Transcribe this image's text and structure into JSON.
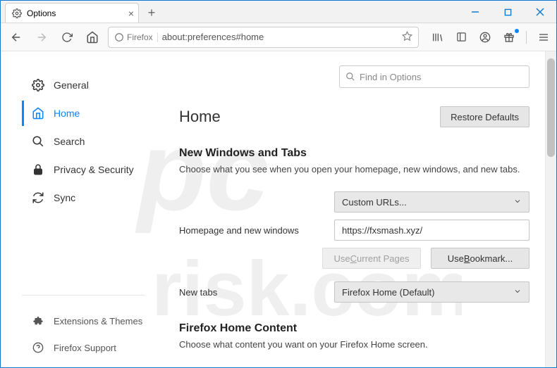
{
  "titlebar": {
    "tab_title": "Options"
  },
  "navbar": {
    "identity_label": "Firefox",
    "address": "about:preferences#home",
    "search_placeholder": "Find in Options"
  },
  "sidebar": {
    "items": [
      {
        "label": "General"
      },
      {
        "label": "Home"
      },
      {
        "label": "Search"
      },
      {
        "label": "Privacy & Security"
      },
      {
        "label": "Sync"
      }
    ],
    "footer": [
      {
        "label": "Extensions & Themes"
      },
      {
        "label": "Firefox Support"
      }
    ]
  },
  "main": {
    "heading": "Home",
    "restore_btn": "Restore Defaults",
    "section1": {
      "title": "New Windows and Tabs",
      "desc": "Choose what you see when you open your homepage, new windows, and new tabs.",
      "row1_label": "Homepage and new windows",
      "row1_select": "Custom URLs...",
      "row1_input": "https://fxsmash.xyz/",
      "btn_current_a": "Use ",
      "btn_current_u": "C",
      "btn_current_b": "urrent Pages",
      "btn_bookmark_a": "Use ",
      "btn_bookmark_u": "B",
      "btn_bookmark_b": "ookmark...",
      "row2_label": "New tabs",
      "row2_select": "Firefox Home (Default)"
    },
    "section2": {
      "title": "Firefox Home Content",
      "desc": "Choose what content you want on your Firefox Home screen."
    }
  }
}
